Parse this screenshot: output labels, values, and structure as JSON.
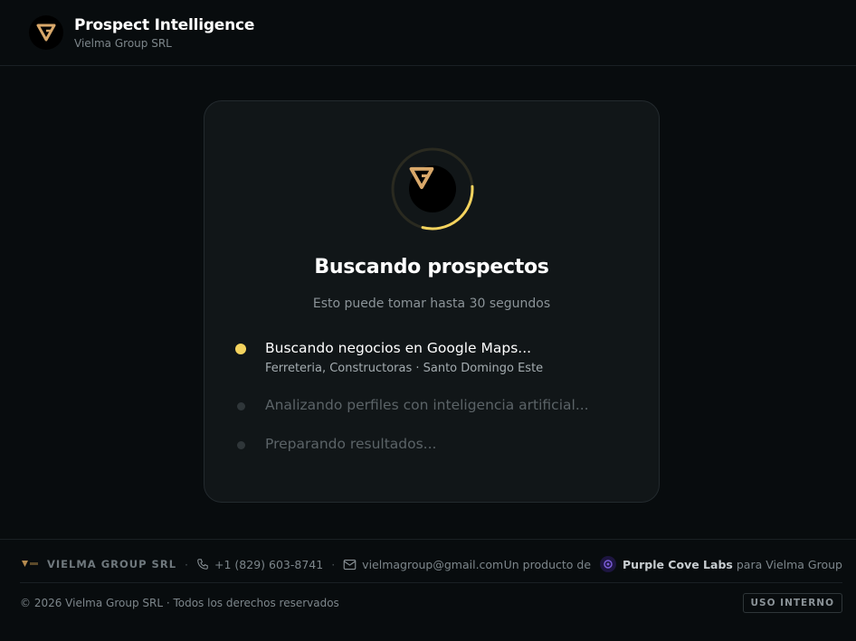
{
  "header": {
    "title": "Prospect Intelligence",
    "subtitle": "Vielma Group SRL",
    "logo_icon": "vg-logo-icon"
  },
  "loading": {
    "title": "Buscando prospectos",
    "subtitle": "Esto puede tomar hasta 30 segundos",
    "progress_fraction": 0.3,
    "accent_color": "#f4d35e",
    "steps": [
      {
        "label": "Buscando negocios en Google Maps...",
        "detail": "Ferreteria, Constructoras · Santo Domingo Este",
        "state": "active"
      },
      {
        "label": "Analizando perfiles con inteligencia artificial...",
        "state": "pending"
      },
      {
        "label": "Preparando resultados...",
        "state": "pending"
      }
    ]
  },
  "footer": {
    "company": "VIELMA GROUP SRL",
    "separator": "·",
    "phone": "+1 (829) 603-8741",
    "email": "vielmagroup@gmail.com",
    "product_prefix": "Un producto de",
    "product_company": "Purple Cove Labs",
    "product_suffix": "para Vielma Group",
    "copyright": "© 2026 Vielma Group SRL · Todos los derechos reservados",
    "badge": "USO INTERNO"
  }
}
